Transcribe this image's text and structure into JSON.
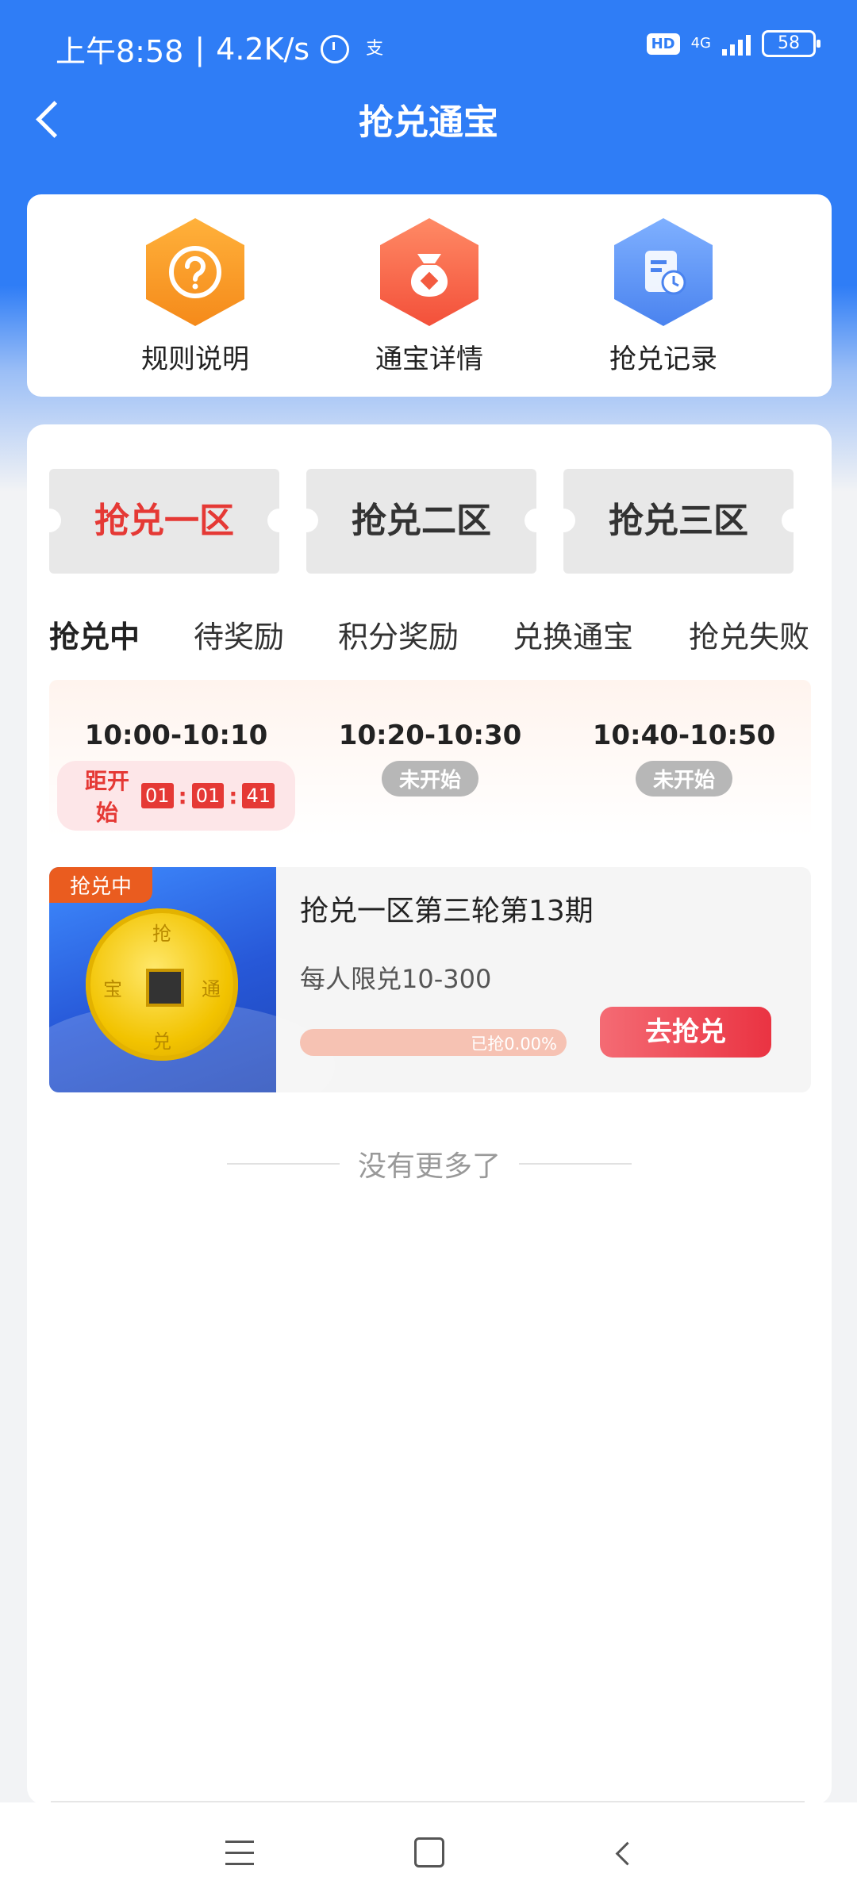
{
  "status_bar": {
    "time": "上午8:58",
    "speed": "4.2K/s",
    "app_icon": "支",
    "hd": "HD",
    "network": "4G",
    "battery": "58"
  },
  "header": {
    "title": "抢兑通宝",
    "back_icon": "chevron-left-icon"
  },
  "menu": [
    {
      "label": "规则说明",
      "icon": "question-icon",
      "color": "#f7931e"
    },
    {
      "label": "通宝详情",
      "icon": "money-bag-icon",
      "color": "#f35b40"
    },
    {
      "label": "抢兑记录",
      "icon": "record-clock-icon",
      "color": "#4a83ef"
    }
  ],
  "zones": [
    {
      "label": "抢兑一区",
      "active": true
    },
    {
      "label": "抢兑二区",
      "active": false
    },
    {
      "label": "抢兑三区",
      "active": false
    }
  ],
  "sub_tabs": [
    {
      "label": "抢兑中",
      "active": true
    },
    {
      "label": "待奖励",
      "active": false
    },
    {
      "label": "积分奖励",
      "active": false
    },
    {
      "label": "兑换通宝",
      "active": false
    },
    {
      "label": "抢兑失败",
      "active": false
    }
  ],
  "time_slots": [
    {
      "time": "10:00-10:10",
      "countdown_label": "距开始",
      "countdown": [
        "01",
        "01",
        "41"
      ]
    },
    {
      "time": "10:20-10:30",
      "status": "未开始"
    },
    {
      "time": "10:40-10:50",
      "status": "未开始"
    }
  ],
  "product": {
    "ribbon": "抢兑中",
    "title": "抢兑一区第三轮第13期",
    "limit": "每人限兑10-300",
    "progress_text": "已抢0.00%",
    "progress": 0.0,
    "button": "去抢兑",
    "coin_chars": [
      "抢",
      "宝",
      "通",
      "兑"
    ]
  },
  "footer": {
    "no_more": "没有更多了"
  },
  "colors": {
    "primary_blue": "#2f7df6",
    "accent_red": "#e53935",
    "ribbon_orange": "#ea5c1f"
  }
}
